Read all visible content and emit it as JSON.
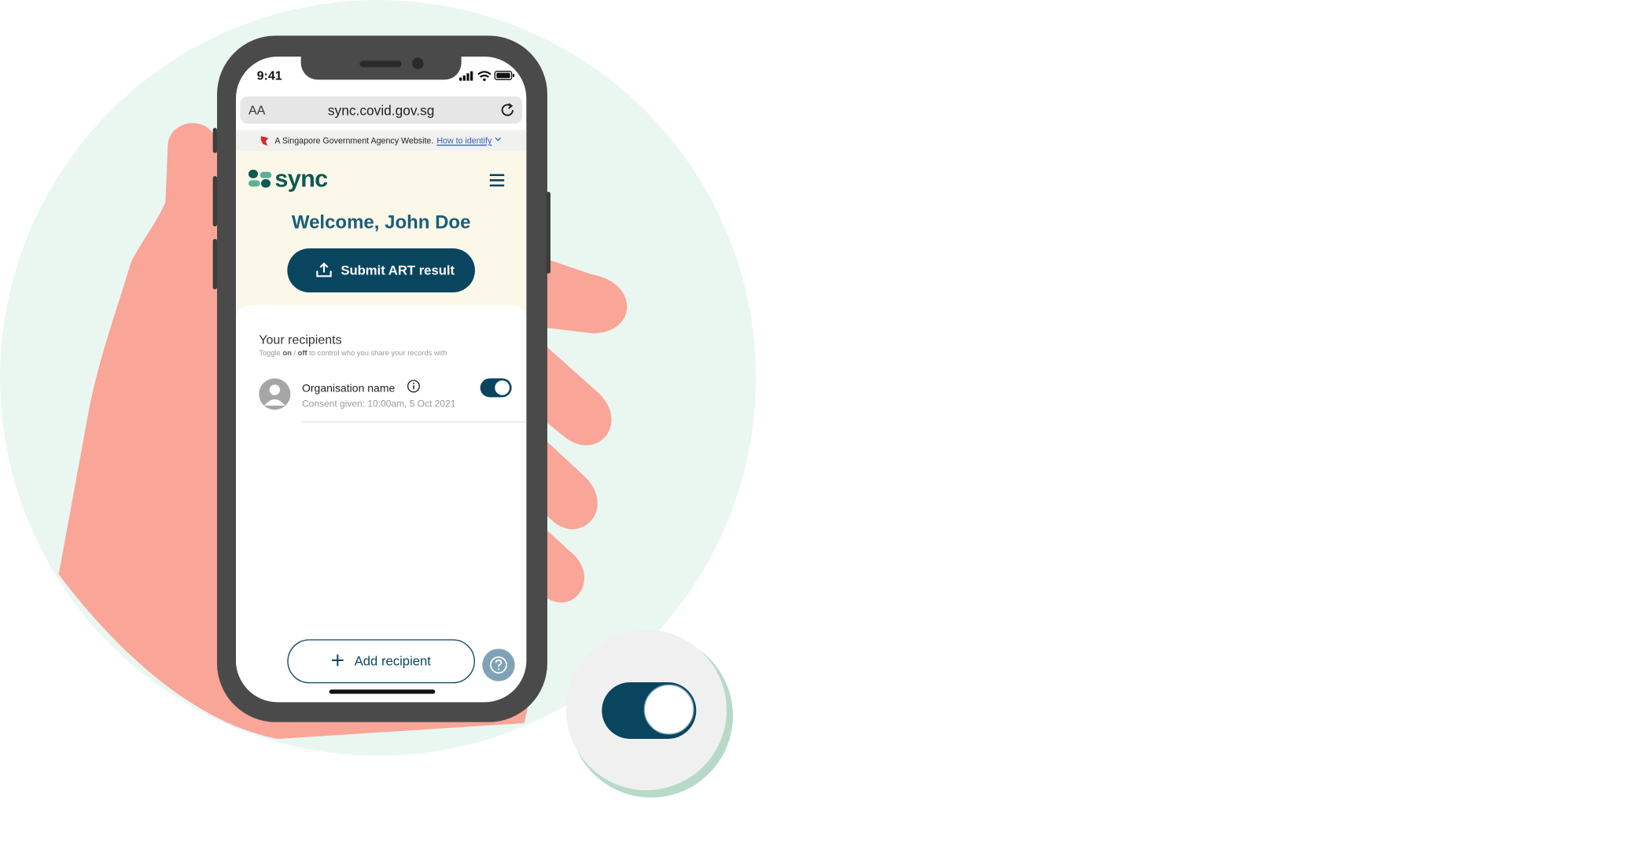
{
  "status_bar": {
    "time": "9:41"
  },
  "browser": {
    "text_size": "AA",
    "url": "sync.covid.gov.sg"
  },
  "gov_banner": {
    "text": "A Singapore Government Agency Website.",
    "link": "How to identify"
  },
  "app": {
    "logo_text": "sync",
    "welcome": "Welcome, John Doe",
    "submit_button": "Submit ART result"
  },
  "recipients": {
    "title": "Your recipients",
    "subtitle_pre": "Toggle ",
    "subtitle_on": "on",
    "subtitle_mid": " / ",
    "subtitle_off": "off",
    "subtitle_post": " to control who you share your records with",
    "items": [
      {
        "name": "Organisation name",
        "consent": "Consent given: 10:00am, 5 Oct 2021",
        "enabled": true
      }
    ]
  },
  "add_button": "Add recipient",
  "colors": {
    "primary": "#0a4560",
    "header_bg": "#fbf8e9",
    "bg_circle": "#eaf7f1",
    "hand": "#f9a597"
  },
  "zoom_toggle": {
    "enabled": true
  }
}
